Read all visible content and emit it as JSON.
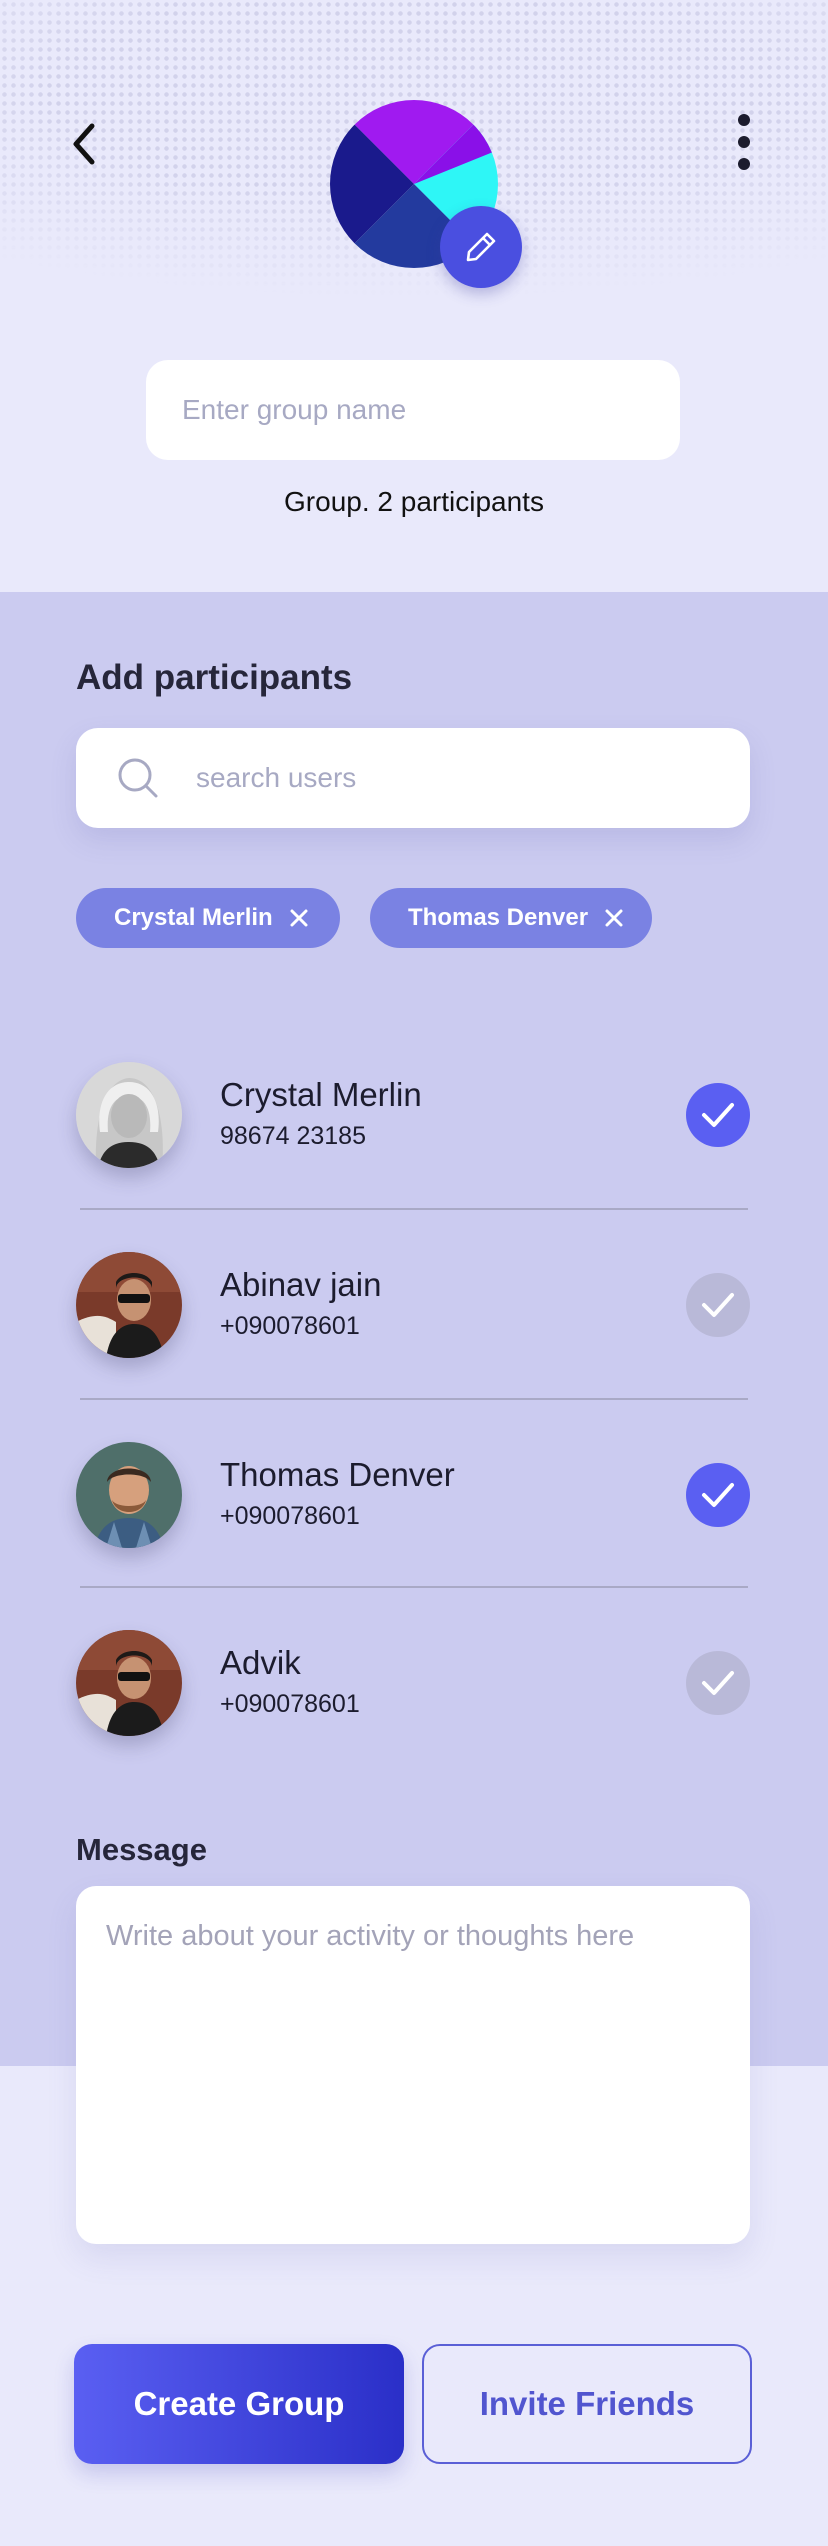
{
  "header": {
    "back_icon": "chevron-left-icon",
    "more_icon": "more-vertical-icon",
    "edit_icon": "pencil-icon"
  },
  "group": {
    "name_placeholder": "Enter group name",
    "participants_text": "Group. 2 participants"
  },
  "add_participants": {
    "title": "Add participants",
    "search_placeholder": "search users",
    "selected_chips": [
      {
        "label": "Crystal Merlin"
      },
      {
        "label": "Thomas Denver"
      }
    ]
  },
  "contacts": [
    {
      "name": "Crystal Merlin",
      "phone": "98674 23185",
      "selected": true
    },
    {
      "name": "Abinav jain",
      "phone": "+090078601",
      "selected": false
    },
    {
      "name": "Thomas Denver",
      "phone": "+090078601",
      "selected": true
    },
    {
      "name": "Advik",
      "phone": "+090078601",
      "selected": false
    }
  ],
  "message": {
    "label": "Message",
    "placeholder": "Write about your activity or thoughts here"
  },
  "actions": {
    "create_label": "Create Group",
    "invite_label": "Invite Friends"
  },
  "colors": {
    "accent": "#5a5ff2",
    "chip": "#7a82e3",
    "check_selected": "#5a5ff2",
    "check_unselected": "#b9b9d8"
  }
}
